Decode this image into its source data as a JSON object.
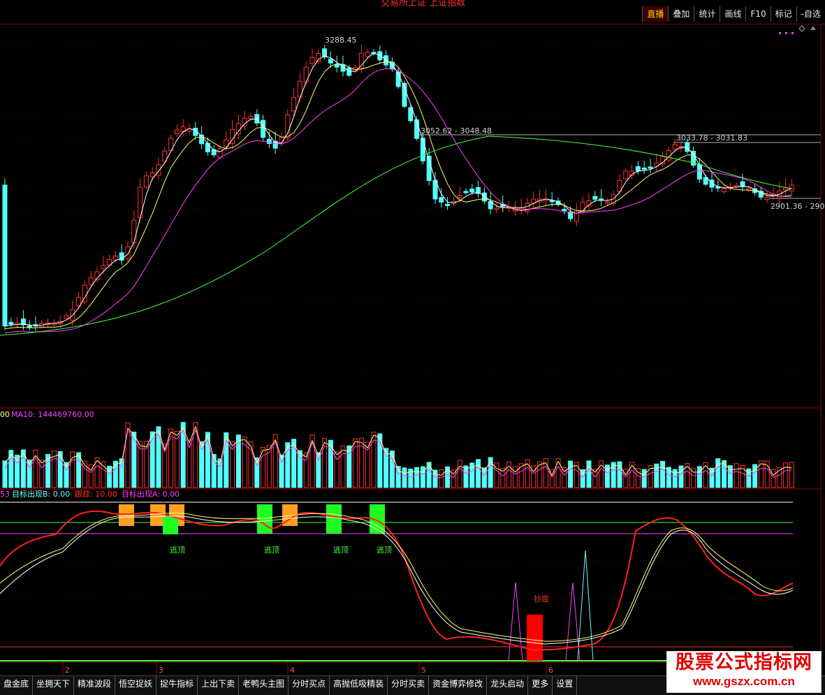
{
  "window": {
    "title_partial": "交易所上证  上证指数"
  },
  "top_menu": [
    "直播",
    "叠加",
    "统计",
    "画线",
    "F10",
    "标记",
    "-自选"
  ],
  "price_panel": {
    "high_label": "3288.45",
    "mid_label_left": "3052.62 - 3048.48",
    "mid_label_right": "3033.78 - 3031.83",
    "low_label": "2901.36 - 290",
    "colors": {
      "up": "#ff3030",
      "down": "#54ffff",
      "ma5": "#ffffff",
      "ma10": "#ffff66",
      "ma20": "#ff40ff",
      "ma60": "#40ff40"
    }
  },
  "volume_panel": {
    "left_prefix": "00",
    "ma10_label": "MA10: 144469760.00"
  },
  "indicator_panel": {
    "prefix": "53",
    "label_b": "目标出现B: 0.00",
    "label_track": "跟踪: 10.00",
    "label_a": "目标出现A: 0.00",
    "escape_text": "逃顶",
    "bottom_text": "抄底"
  },
  "time_axis": [
    "2",
    "3",
    "4",
    "5",
    "6"
  ],
  "bottom_tabs": [
    "盘金底",
    "坐拥天下",
    "精准波段",
    "悟空捉妖",
    "捉牛指标",
    "上出下卖",
    "老鸭头主图",
    "分时买点",
    "高抛低吸精装",
    "分时买卖",
    "资金博弈修改",
    "龙头启动",
    "更多",
    "设置"
  ],
  "watermark": {
    "title": "股票公式指标网",
    "url": "www.gszx.com.cn"
  }
}
